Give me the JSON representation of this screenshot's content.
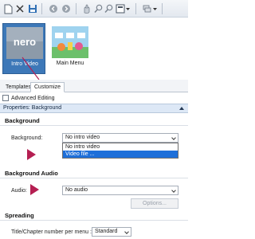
{
  "toolbar": {
    "icons": [
      "new-page-icon",
      "delete-icon",
      "save-icon",
      "back-icon",
      "forward-icon",
      "hand-icon",
      "zoom-in-icon",
      "zoom-out-icon",
      "layout-icon",
      "layers-icon"
    ]
  },
  "preview": {
    "items": [
      {
        "label": "Intro Video",
        "logo": "nero",
        "selected": true
      },
      {
        "label": "Main Menu",
        "selected": false
      }
    ]
  },
  "tabs": [
    {
      "label": "Templates",
      "active": false
    },
    {
      "label": "Customize",
      "active": true
    }
  ],
  "advanced_editing": {
    "label": "Advanced Editing",
    "checked": false
  },
  "properties": {
    "header": "Properties: Background"
  },
  "background": {
    "section_title": "Background",
    "field_label": "Background:",
    "value": "No intro video",
    "options": [
      "No intro video",
      "Video file ..."
    ],
    "highlighted_option": "Video file ..."
  },
  "background_audio": {
    "section_title": "Background Audio",
    "field_label": "Audio:",
    "value": "No audio",
    "options_button": "Options..."
  },
  "spreading": {
    "section_title": "Spreading",
    "field_label": "Title/Chapter number per menu :",
    "value": "Standard"
  },
  "colors": {
    "accent": "#3d78b8",
    "pointer": "#b51f52",
    "highlight": "#1e6fd9"
  }
}
